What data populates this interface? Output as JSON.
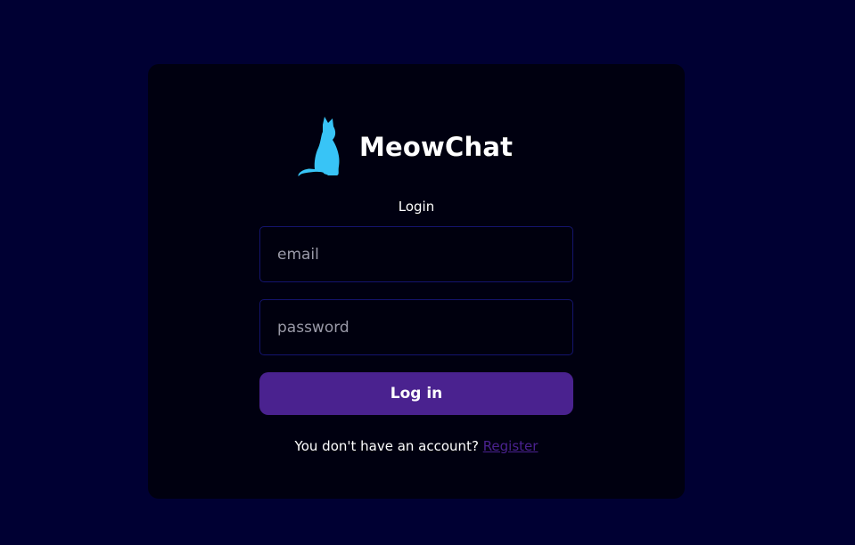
{
  "brand": {
    "name": "MeowChat",
    "logo_icon": "cat-icon"
  },
  "login": {
    "heading": "Login",
    "email_placeholder": "email",
    "password_placeholder": "password",
    "submit_label": "Log in",
    "register_prompt": "You don't have an account?",
    "register_link": "Register"
  },
  "colors": {
    "page_background": "#000033",
    "card_background": "#000010",
    "accent": "#4a228f",
    "logo": "#38c4f6",
    "field_border": "#14146e"
  }
}
